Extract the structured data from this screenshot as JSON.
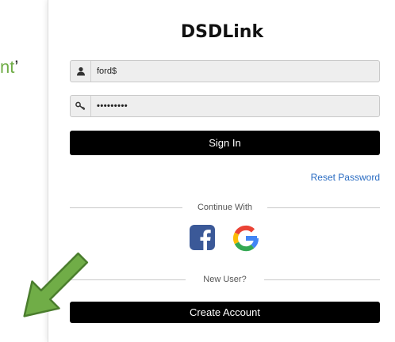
{
  "background_fragment": {
    "green_text": "nt",
    "tail_text": "’"
  },
  "app": {
    "brand": "DSDLink"
  },
  "login": {
    "username_value": "ford$",
    "password_value": "•••••••••",
    "sign_in_label": "Sign In",
    "reset_label": "Reset Password"
  },
  "social": {
    "continue_label": "Continue With"
  },
  "signup": {
    "new_user_label": "New User?",
    "create_account_label": "Create Account"
  },
  "colors": {
    "accent_green": "#70ad47",
    "link_blue": "#2a6cc2",
    "facebook_blue": "#3b5998",
    "button_black": "#000000"
  },
  "icons": [
    "user-icon",
    "key-icon",
    "facebook-icon",
    "google-icon",
    "arrow-icon"
  ]
}
